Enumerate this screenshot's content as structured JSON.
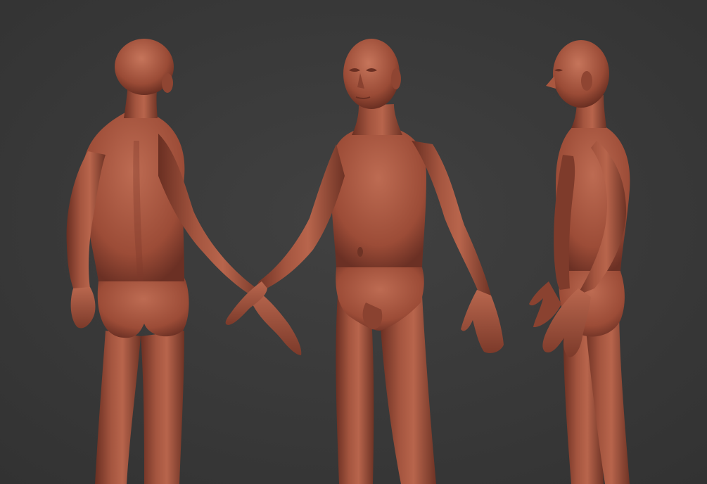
{
  "scene": {
    "background_color": "#3a3a3a",
    "material_color": "#a0503c",
    "material_highlight": "#c8745a",
    "material_shadow": "#5e2a1e",
    "figures": [
      {
        "name": "figure-back-view",
        "view": "back"
      },
      {
        "name": "figure-front-view",
        "view": "front"
      },
      {
        "name": "figure-side-view",
        "view": "side"
      }
    ]
  }
}
